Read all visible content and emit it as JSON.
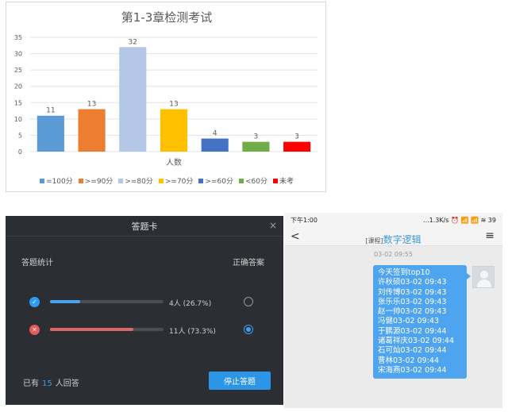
{
  "chart_data": {
    "type": "bar",
    "title": "第1-3章检测考试",
    "xlabel": "人数",
    "ylabel": "",
    "ylim": [
      0,
      35
    ],
    "yticks": [
      0,
      5,
      10,
      15,
      20,
      25,
      30,
      35
    ],
    "grid": true,
    "legend_position": "bottom",
    "categories": [
      "=100分",
      ">=90分",
      ">=80分",
      ">=70分",
      ">=60分",
      "<60分",
      "未考"
    ],
    "values": [
      11,
      13,
      32,
      13,
      4,
      3,
      3
    ],
    "colors": [
      "#5b9bd5",
      "#ed7d31",
      "#b4c7e7",
      "#ffc000",
      "#4472c4",
      "#70ad47",
      "#ff0000"
    ]
  },
  "dialog": {
    "title": "答题卡",
    "close_icon": "×",
    "stats_label": "答题统计",
    "correct_label": "正确答案",
    "rows": [
      {
        "icon": "✓",
        "fraction": 0.267,
        "text": "4人 (26.7%)",
        "correct": false
      },
      {
        "icon": "✕",
        "fraction": 0.733,
        "text": "11人 (73.3%)",
        "correct": true
      }
    ],
    "answered_prefix": "已有",
    "answered_count": "15",
    "answered_suffix": "人回答",
    "stop_label": "停止答题",
    "accent": "#2d95e6"
  },
  "phone": {
    "status_time": "下午1:00",
    "status_right": "...1.3K/s ⏰ 📶 📶 ≋ 39",
    "back_icon": "<",
    "nav_tag": "[课程]",
    "nav_name": "数字逻辑",
    "menu_icon": "≡",
    "timestamp": "03-02 09:55",
    "message_lines": [
      "今天签到top10",
      "许秋硕03-02 09:43",
      "刘传博03-02 09:43",
      "张乐乐03-02 09:43",
      "赵一帅03-02 09:43",
      "冯健03-02 09:43",
      "于鹏源03-02 09:44",
      "诸葛祥庆03-02 09:44",
      "石可灿03-02 09:44",
      "曹林03-02 09:44",
      "宋海燕03-02 09:44"
    ]
  }
}
